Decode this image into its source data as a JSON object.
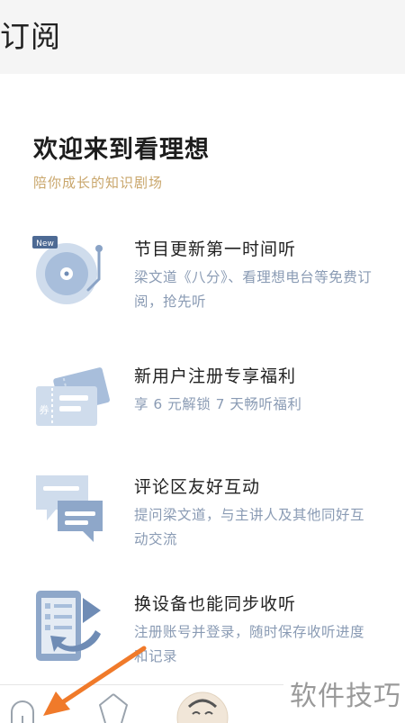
{
  "header": {
    "title": "订阅"
  },
  "welcome": {
    "title": "欢迎来到看理想",
    "subtitle": "陪你成长的知识剧场"
  },
  "features": [
    {
      "badge": "New",
      "icon": "record-player-icon",
      "title": "节目更新第一时间听",
      "desc": "梁文道《八分》、看理想电台等免费订阅，抢先听"
    },
    {
      "badge": "券",
      "icon": "coupon-ticket-icon",
      "title": "新用户注册专享福利",
      "desc": "享 6 元解锁 7 天畅听福利"
    },
    {
      "icon": "chat-bubbles-icon",
      "title": "评论区友好互动",
      "desc": "提问梁文道，与主讲人及其他同好互动交流"
    },
    {
      "icon": "device-sync-icon",
      "title": "换设备也能同步收听",
      "desc": "注册账号并登录，随时保存收听进度和记录"
    }
  ],
  "tabbar": {
    "items": [
      "home-tab-icon",
      "discover-tab-icon",
      "avatar-tab"
    ]
  },
  "watermark": "软件技巧",
  "colors": {
    "accent": "#c9a66b",
    "desc_text": "#8a9bb4",
    "arrow": "#f07a2a"
  }
}
